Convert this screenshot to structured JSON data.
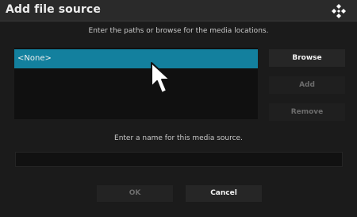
{
  "dialog": {
    "title": "Add file source",
    "paths_instruction": "Enter the paths or browse for the media locations.",
    "name_instruction": "Enter a name for this media source.",
    "name_value": ""
  },
  "paths_list": {
    "items": [
      {
        "label": "<None>",
        "selected": true
      }
    ]
  },
  "side_buttons": {
    "browse": "Browse",
    "add": "Add",
    "remove": "Remove"
  },
  "bottom_buttons": {
    "ok": "OK",
    "cancel": "Cancel"
  },
  "icons": {
    "logo": "kodi-logo-icon",
    "cursor": "mouse-pointer-icon"
  },
  "colors": {
    "title_bar": "#2a2a2a",
    "selection": "#13809e",
    "background": "#1b1b1b"
  }
}
